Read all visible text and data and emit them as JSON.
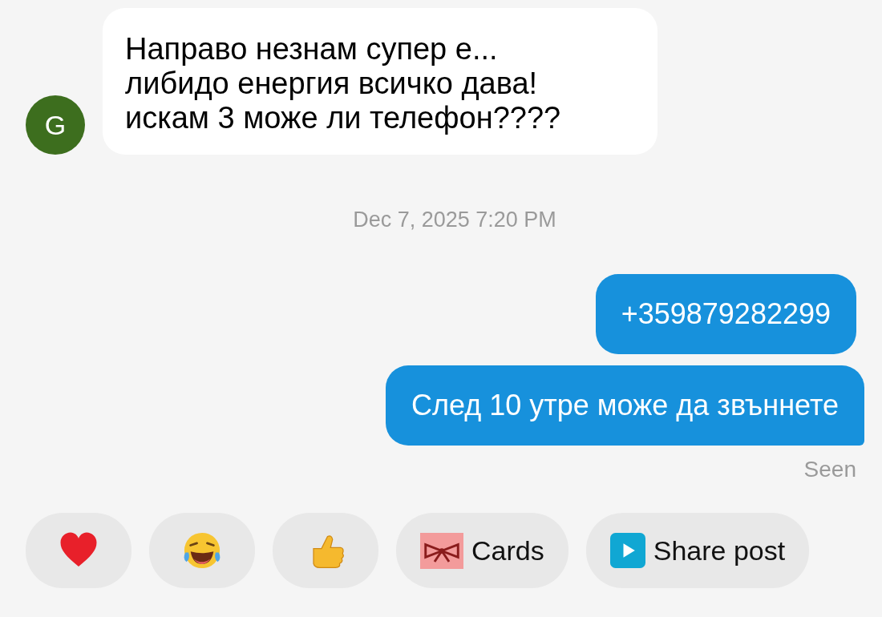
{
  "messages": [
    {
      "kind": "incoming",
      "avatar": "G",
      "color": "#3d6e1e",
      "text": "Направо незнам супер е...\nлибидо енергия всичко дава!\nискам 3 може ли телефон????"
    },
    {
      "kind": "timestamp",
      "text": "Dec 7, 2025 7:20 PM"
    },
    {
      "kind": "outgoing",
      "text": "+359879282299"
    },
    {
      "kind": "outgoing",
      "text": "След 10 утре може да звъннете",
      "tail": true
    },
    {
      "kind": "status",
      "text": "Seen"
    }
  ],
  "quick_replies": [
    {
      "kind": "heart"
    },
    {
      "kind": "laugh"
    },
    {
      "kind": "thumbs-up"
    },
    {
      "kind": "cards",
      "label": "Cards"
    },
    {
      "kind": "share",
      "label": "Share post"
    }
  ]
}
